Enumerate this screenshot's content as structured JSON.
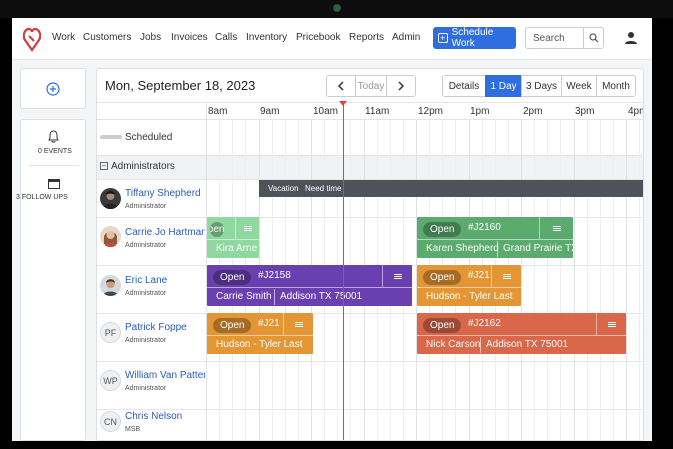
{
  "nav": {
    "items": [
      "Work",
      "Customers",
      "Jobs",
      "Invoices",
      "Calls",
      "Inventory",
      "Pricebook",
      "Reports",
      "Admin"
    ],
    "schedule_button": "Schedule Work",
    "search_placeholder": "Search"
  },
  "sidebar": {
    "events_label": "0 EVENTS",
    "followups_label": "3 FOLLOW UPS"
  },
  "toolbar": {
    "date": "Mon, September 18, 2023",
    "today": "Today",
    "views": [
      "Details",
      "1 Day",
      "3 Days",
      "Week",
      "Month"
    ],
    "active_view": "1 Day"
  },
  "timeline": {
    "hours": [
      "8am",
      "9am",
      "10am",
      "11am",
      "12pm",
      "1pm",
      "2pm",
      "3pm",
      "4pm"
    ]
  },
  "rows": {
    "scheduled_label": "Scheduled",
    "group_label": "Administrators"
  },
  "technicians": [
    {
      "name": "Tiffany Shepherd",
      "role": "Administrator",
      "initials": ""
    },
    {
      "name": "Carrie Jo Hartman",
      "role": "Administrator",
      "initials": ""
    },
    {
      "name": "Eric Lane",
      "role": "Administrator",
      "initials": ""
    },
    {
      "name": "Patrick Foppe",
      "role": "Administrator",
      "initials": "PF"
    },
    {
      "name": "William Van Patten",
      "role": "Administrator",
      "initials": "WP"
    },
    {
      "name": "Chris Nelson",
      "role": "MSB",
      "initials": "CN"
    }
  ],
  "vacation": {
    "label": "Vacation",
    "note": "Need time"
  },
  "jobs": [
    {
      "status": "Open",
      "id": "",
      "customer": "Kira Arne",
      "address": "",
      "color": "#8fd9a0"
    },
    {
      "status": "Open",
      "id": "#J2160",
      "customer": "Karen Shepherd",
      "address": "Grand Prairie TX",
      "color": "#5bab6e"
    },
    {
      "status": "Open",
      "id": "#J2158",
      "customer": "Carrie Smith",
      "address": "Addison TX 75001",
      "color": "#6a3fb0"
    },
    {
      "status": "Open",
      "id": "#J21",
      "customer": "Hudson - Tyler Last",
      "address": "",
      "color": "#e49634"
    },
    {
      "status": "Open",
      "id": "#J21",
      "customer": "Hudson - Tyler Last",
      "address": "",
      "color": "#e49634"
    },
    {
      "status": "Open",
      "id": "#J2162",
      "customer": "Nick Carson",
      "address": "Addison TX 75001",
      "color": "#d9674a"
    }
  ],
  "colors": {
    "accent": "#2f6ee0",
    "now_line": "#e0453a",
    "vacation": "#4d5359"
  }
}
